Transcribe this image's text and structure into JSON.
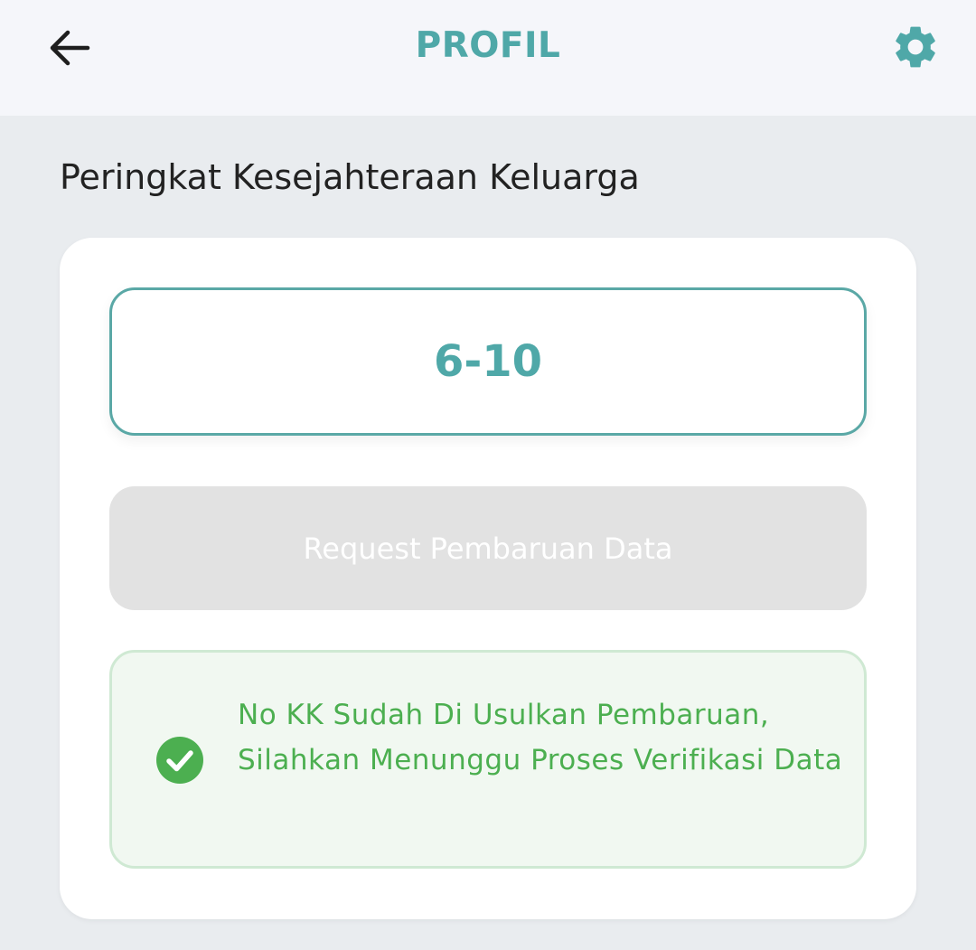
{
  "header": {
    "title": "PROFIL",
    "back_icon": "arrow-left-icon",
    "settings_icon": "gear-icon",
    "accent_color": "#4fa8a8"
  },
  "section": {
    "title": "Peringkat Kesejahteraan Keluarga"
  },
  "rank": {
    "value": "6-10"
  },
  "request_button": {
    "label": "Request Pembaruan Data",
    "state": "disabled"
  },
  "notice": {
    "icon": "check-circle-icon",
    "color": "#4caf50",
    "text": "No KK Sudah Di Usulkan Pembaruan, Silahkan Menunggu Proses Verifikasi Data"
  }
}
